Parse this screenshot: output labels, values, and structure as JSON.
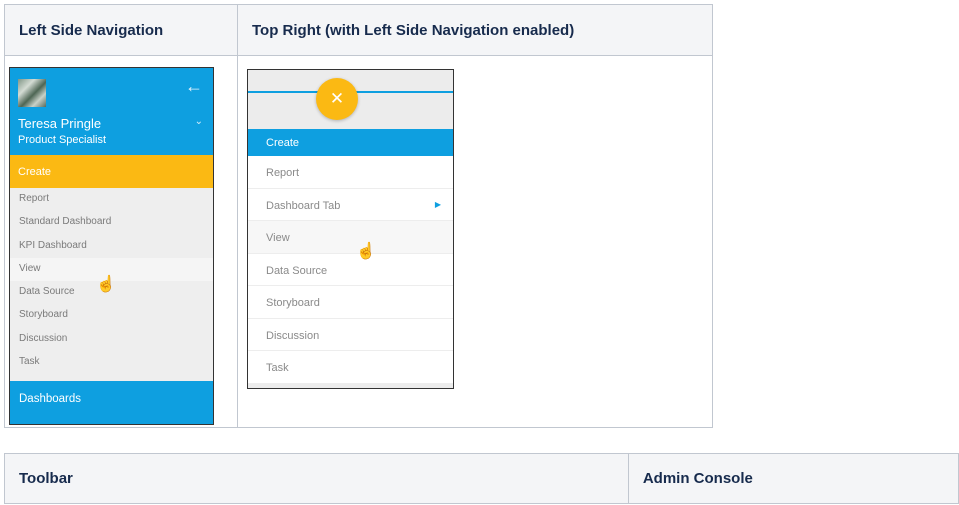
{
  "table1": {
    "headers": [
      "Left Side Navigation",
      "Top Right (with Left Side Navigation enabled)"
    ]
  },
  "left_nav": {
    "user_name": "Teresa Pringle",
    "user_role": "Product Specialist",
    "create_label": "Create",
    "items": [
      "Report",
      "Standard Dashboard",
      "KPI Dashboard",
      "View",
      "Data Source",
      "Storyboard",
      "Discussion",
      "Task"
    ],
    "dashboards_label": "Dashboards",
    "icons": {
      "back": "arrow-left-icon",
      "expand": "chevron-down-icon",
      "cursor": "hand-pointer-icon"
    }
  },
  "top_right_menu": {
    "fab_icon": "close-icon",
    "create_label": "Create",
    "items": [
      "Report",
      "Dashboard Tab",
      "View",
      "Data Source",
      "Storyboard",
      "Discussion",
      "Task"
    ],
    "icons": {
      "submenu": "caret-right-icon",
      "cursor": "hand-pointer-icon"
    }
  },
  "table2": {
    "headers": [
      "Toolbar",
      "Admin Console"
    ]
  },
  "colors": {
    "blue": "#0e9fe0",
    "yellow": "#fbb913",
    "header_bg": "#f4f5f7"
  }
}
